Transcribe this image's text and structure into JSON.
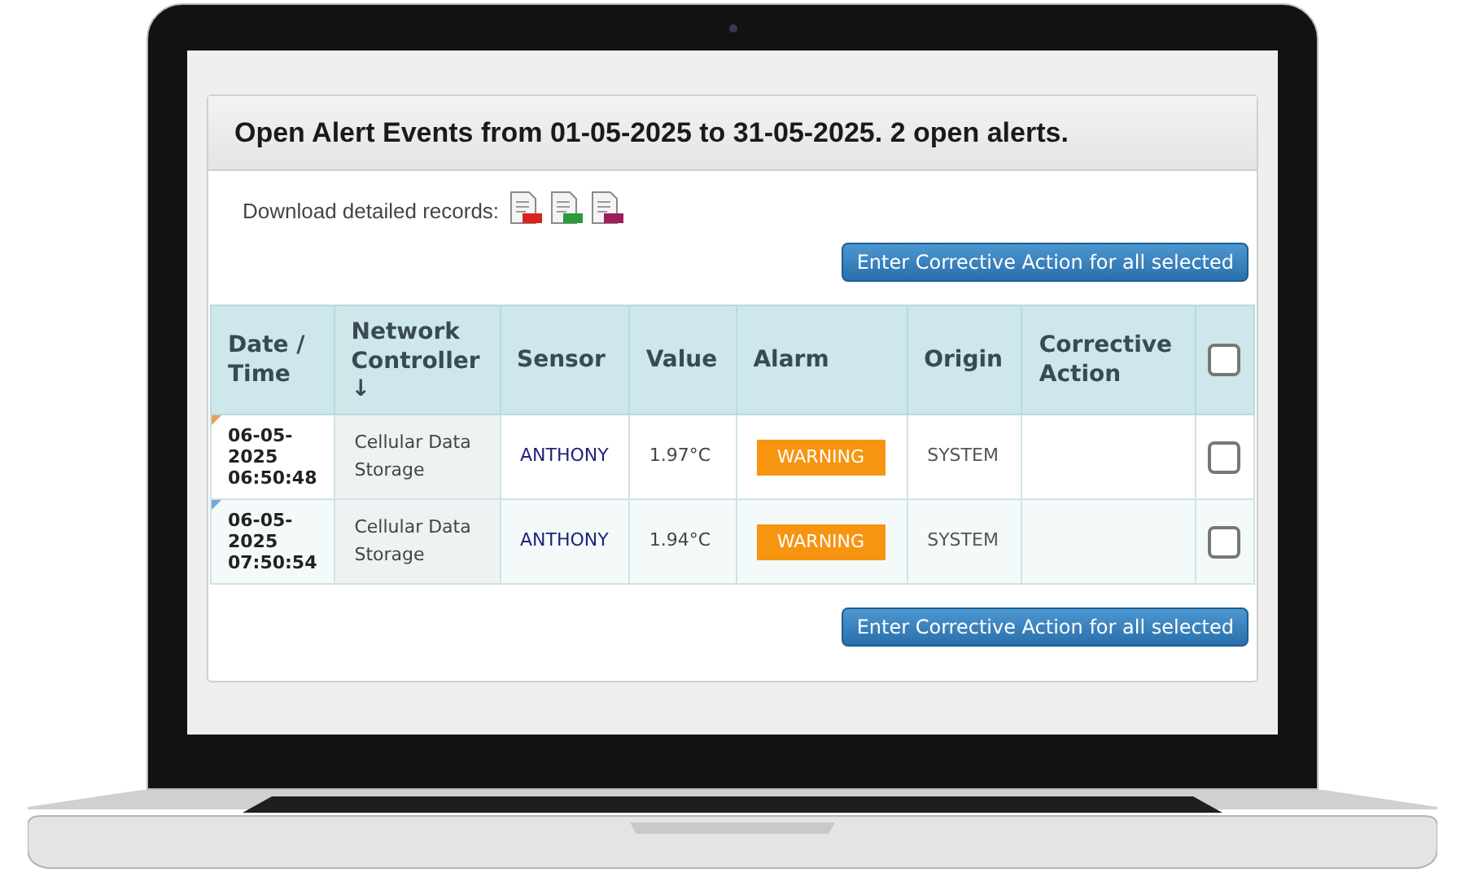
{
  "panel": {
    "title": "Open Alert Events from 01-05-2025 to 31-05-2025. 2 open alerts.",
    "download_label": "Download detailed records:",
    "downloads": [
      {
        "kind": "pdf"
      },
      {
        "kind": "xl"
      },
      {
        "kind": "csv"
      }
    ],
    "action_buttons": [
      "Enter Corrective Action for all selected",
      "Enter Corrective Action for all selected"
    ]
  },
  "table": {
    "columns": [
      {
        "label": "Date / Time"
      },
      {
        "label": "Network Controller",
        "sort_arrow": "↓"
      },
      {
        "label": "Sensor"
      },
      {
        "label": "Value"
      },
      {
        "label": "Alarm"
      },
      {
        "label": "Origin"
      },
      {
        "label": "Corrective Action"
      }
    ],
    "select_all_checked": false,
    "rows": [
      {
        "color": "#e0a060",
        "date": "06-05-2025",
        "time": "06:50:48",
        "network_controller": "Cellular Data Storage",
        "sensor": "ANTHONY",
        "value": "1.97°C",
        "alarm": "WARNING",
        "origin": "SYSTEM",
        "checked": false
      },
      {
        "color": "#70a8d8",
        "date": "06-05-2025",
        "time": "07:50:54",
        "network_controller": "Cellular Data Storage",
        "sensor": "ANTHONY",
        "value": "1.94°C",
        "alarm": "WARNING",
        "origin": "SYSTEM",
        "checked": false
      }
    ]
  }
}
